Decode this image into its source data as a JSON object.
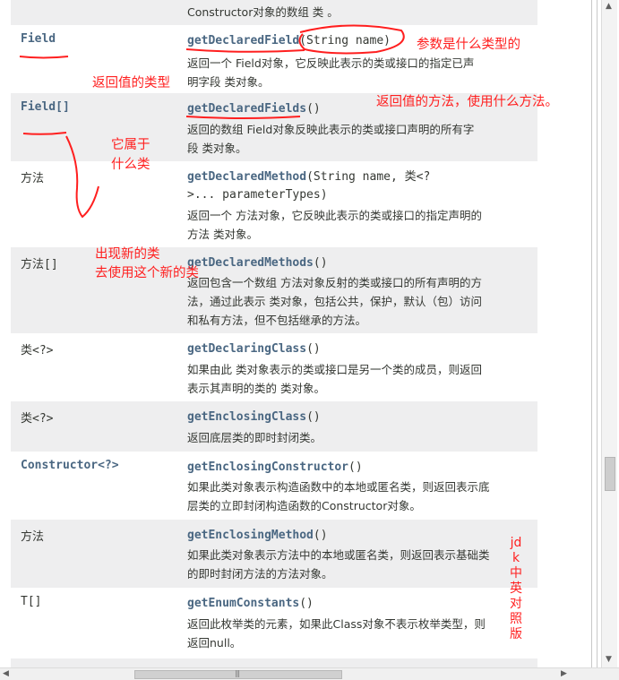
{
  "top_row": {
    "desc": "Constructor对象的数组 类 。"
  },
  "rows": [
    {
      "type": "Field",
      "method_name": "getDeclaredField",
      "params": "(String name)",
      "desc": [
        "返回一个 Field对象，它反映此表示的类或接口的指定已声",
        "明字段 类对象。"
      ]
    },
    {
      "type": "Field[]",
      "method_name": "getDeclaredFields",
      "params": "()",
      "desc": [
        "返回的数组 Field对象反映此表示的类或接口声明的所有字",
        "段 类对象。"
      ]
    },
    {
      "type": "方法",
      "method_name": "getDeclaredMethod",
      "params": "(String name, 类<?",
      "params2": ">... parameterTypes)",
      "desc": [
        "返回一个 方法对象，它反映此表示的类或接口的指定声明的",
        "方法 类对象。"
      ]
    },
    {
      "type": "方法[]",
      "method_name": "getDeclaredMethods",
      "params": "()",
      "desc": [
        "返回包含一个数组 方法对象反射的类或接口的所有声明的方",
        "法，通过此表示 类对象，包括公共，保护，默认（包）访问",
        "和私有方法，但不包括继承的方法。"
      ]
    },
    {
      "type": "类<?>",
      "method_name": "getDeclaringClass",
      "params": "()",
      "desc": [
        "如果由此 类对象表示的类或接口是另一个类的成员，则返回",
        "表示其声明的类的 类对象。"
      ]
    },
    {
      "type": "类<?>",
      "method_name": "getEnclosingClass",
      "params": "()",
      "desc": [
        "返回底层类的即时封闭类。"
      ]
    },
    {
      "type": "Constructor<?>",
      "method_name": "getEnclosingConstructor",
      "params": "()",
      "desc": [
        "如果此类对象表示构造函数中的本地或匿名类，则返回表示底",
        "层类的立即封闭构造函数的Constructor对象。"
      ]
    },
    {
      "type": "方法",
      "method_name": "getEnclosingMethod",
      "params": "()",
      "desc": [
        "如果此类对象表示方法中的本地或匿名类，则返回表示基础类",
        "的即时封闭方法的方法对象。"
      ]
    },
    {
      "type": "T[]",
      "method_name": "getEnumConstants",
      "params": "()",
      "desc": [
        "返回此枚举类的元素，如果此Class对象不表示枚举类型，则",
        "返回null。"
      ]
    }
  ],
  "annotations": {
    "param_type": "参数是什么类型的",
    "return_type": "返回值的类型",
    "method_usage": "返回值的方法，使用什么方法。",
    "belongs1": "它属于",
    "belongs2": "什么类",
    "new_class1": "出现新的类",
    "new_class2": "去使用这个新的类",
    "jdk": "jdk中英对照版"
  },
  "scroll": {
    "up_arrow": "▲",
    "down_arrow": "▼",
    "left_arrow": "◀",
    "right_arrow": "▶",
    "grip": "|||"
  },
  "colors": {
    "link": "#4a6782",
    "text": "#353833",
    "alt_row": "#eeeeef",
    "annotation": "#ff1f1f"
  }
}
